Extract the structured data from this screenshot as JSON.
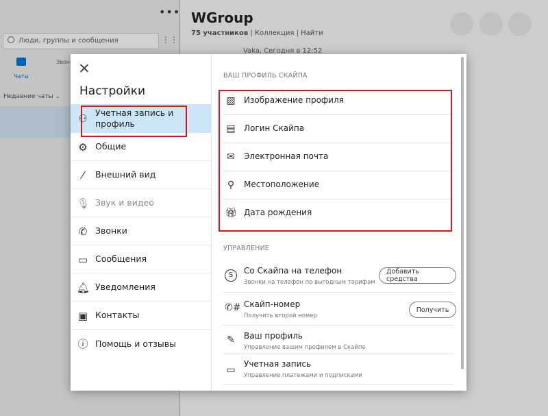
{
  "background": {
    "search_placeholder": "Люди, группы и сообщения",
    "tab_chats": "Чаты",
    "tab_calls": "Звонк",
    "recent_chats": "Недавние чаты",
    "group_title": "WGroup",
    "participants": "75 участников",
    "collection": "Коллекция",
    "find": "Найти",
    "date_line": "Vaka, Сегодня в 12:52"
  },
  "dialog": {
    "title": "Настройки",
    "nav": [
      {
        "label": "Учетная запись и профиль",
        "icon": "person-icon"
      },
      {
        "label": "Общие",
        "icon": "gear-icon"
      },
      {
        "label": "Внешний вид",
        "icon": "magic-wand-icon"
      },
      {
        "label": "Звук и видео",
        "icon": "microphone-icon"
      },
      {
        "label": "Звонки",
        "icon": "phone-icon"
      },
      {
        "label": "Сообщения",
        "icon": "message-icon"
      },
      {
        "label": "Уведомления",
        "icon": "bell-icon"
      },
      {
        "label": "Контакты",
        "icon": "contacts-icon"
      },
      {
        "label": "Помощь и отзывы",
        "icon": "info-icon"
      }
    ],
    "profile_section": "ВАШ ПРОФИЛЬ СКАЙПА",
    "profile_items": [
      {
        "label": "Изображение профиля",
        "icon": "image-icon"
      },
      {
        "label": "Логин Скайпа",
        "icon": "id-card-icon"
      },
      {
        "label": "Электронная почта",
        "icon": "envelope-icon"
      },
      {
        "label": "Местоположение",
        "icon": "location-pin-icon"
      },
      {
        "label": "Дата рождения",
        "icon": "gift-icon"
      }
    ],
    "manage_section": "УПРАВЛЕНИЕ",
    "manage_items": [
      {
        "label": "Со Скайпа на телефон",
        "sub": "Звонки на телефон по выгодным тарифам",
        "button": "Добавить средства",
        "icon": "skype-credit-icon"
      },
      {
        "label": "Скайп-номер",
        "sub": "Получить второй номер",
        "button": "Получить",
        "icon": "phone-number-icon"
      },
      {
        "label": "Ваш профиль",
        "sub": "Управление вашим профилем в Скайпе",
        "icon": "pencil-icon"
      },
      {
        "label": "Учетная запись",
        "sub": "Управление платежами и подписками",
        "icon": "account-card-icon"
      }
    ]
  }
}
